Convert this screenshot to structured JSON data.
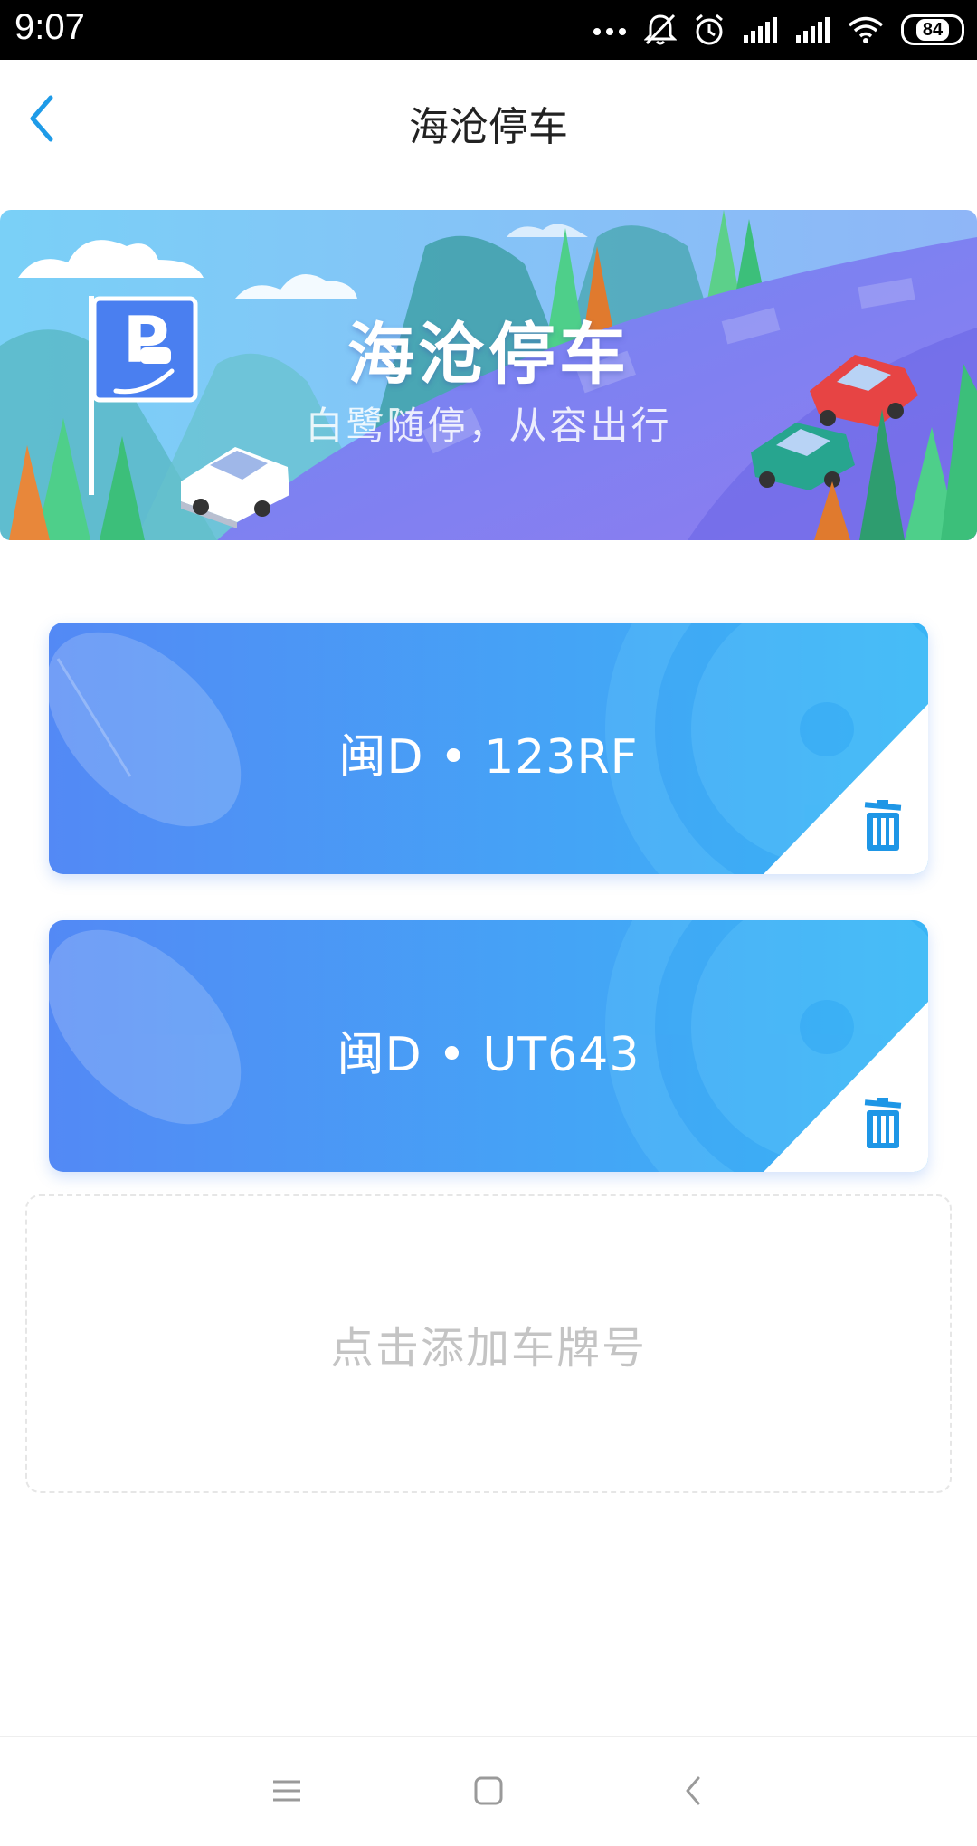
{
  "status_bar": {
    "time": "9:07",
    "battery": "84",
    "icons": [
      "more-dots-icon",
      "mute-icon",
      "alarm-icon",
      "signal-icon",
      "signal-icon",
      "wifi-icon",
      "battery-icon"
    ]
  },
  "header": {
    "title": "海沧停车",
    "back_icon": "chevron-left-icon"
  },
  "banner": {
    "title": "海沧停车",
    "subtitle": "白鹭随停，从容出行"
  },
  "plates": [
    {
      "number": "闽D • 123RF",
      "delete_icon": "trash-icon"
    },
    {
      "number": "闽D • UT643",
      "delete_icon": "trash-icon"
    }
  ],
  "add_plate": {
    "label": "点击添加车牌号"
  },
  "nav_bar": {
    "items": [
      "menu-icon",
      "home-icon",
      "back-icon"
    ]
  },
  "colors": {
    "accent": "#1e9be8",
    "card_start": "#5389f5",
    "card_end": "#3ab7f6",
    "trash": "#1e96e6"
  }
}
